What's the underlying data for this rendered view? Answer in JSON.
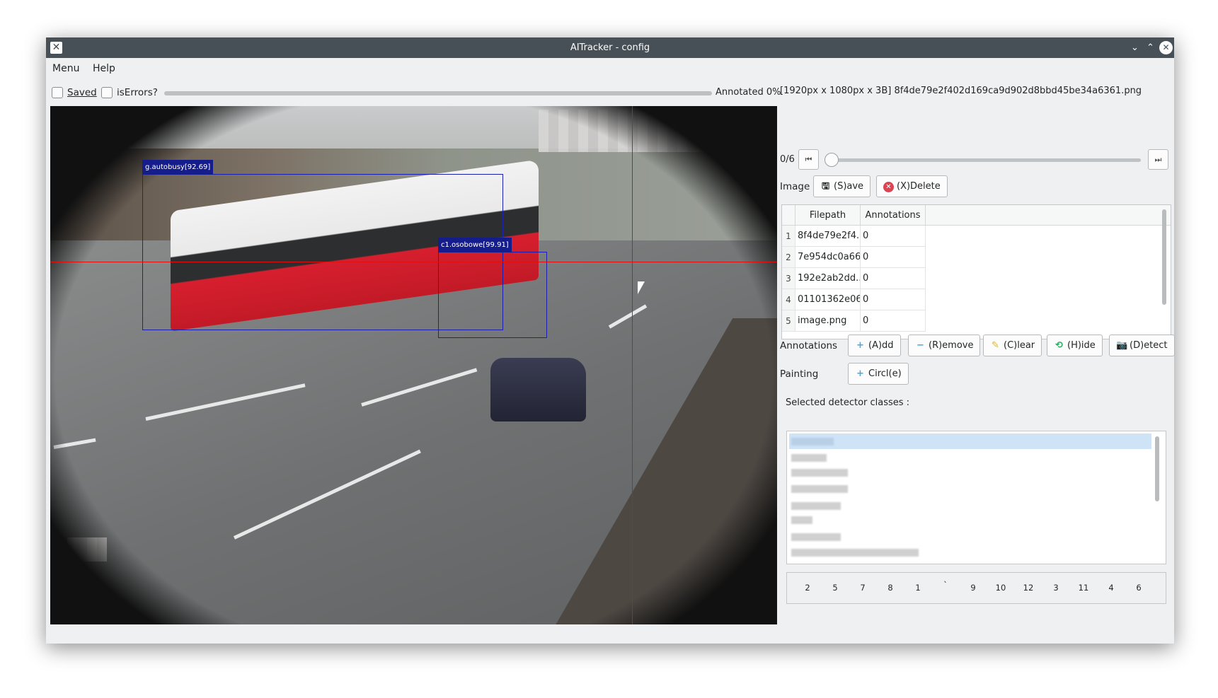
{
  "window": {
    "title": "AITracker - config"
  },
  "menu": {
    "items": [
      "Menu",
      "Help"
    ]
  },
  "toolbar": {
    "saved_label": "Saved",
    "errors_label": "isErrors?",
    "annotated_label": "Annotated 0%"
  },
  "image_info": "[1920px x 1080px x 3B] 8f4de79e2f402d169ca9d902d8bbd45be34a6361.png",
  "navigation": {
    "counter": "0/6",
    "slider_value": 0
  },
  "image_panel": {
    "label": "Image",
    "save": "(S)ave",
    "delete": "(X)Delete"
  },
  "table": {
    "headers": [
      "Filepath",
      "Annotations"
    ],
    "rows": [
      {
        "n": "1",
        "path": "8f4de79e2f4...",
        "ann": "0"
      },
      {
        "n": "2",
        "path": "7e954dc0a66...",
        "ann": "0"
      },
      {
        "n": "3",
        "path": "192e2ab2dd...",
        "ann": "0"
      },
      {
        "n": "4",
        "path": "01101362e06...",
        "ann": "0"
      },
      {
        "n": "5",
        "path": "image.png",
        "ann": "0"
      }
    ]
  },
  "annotations": {
    "label": "Annotations",
    "add": "(A)dd",
    "remove": "(R)emove",
    "clear": "(C)lear",
    "hide": "(H)ide",
    "detect": "(D)etect"
  },
  "painting": {
    "label": "Painting",
    "circle": "Circl(e)"
  },
  "detector": {
    "label": "Selected detector classes :"
  },
  "class_numbers": [
    "2",
    "5",
    "7",
    "8",
    "1",
    "`",
    "9",
    "10",
    "12",
    "3",
    "11",
    "4",
    "6"
  ],
  "detections": [
    {
      "label": "g.autobusy[92.69]"
    },
    {
      "label": "c1.osobowe[99.91]"
    }
  ],
  "colors": {
    "bbox": "#1a1fb0",
    "crosshair": "#e01010",
    "selection": "#cfe3f7"
  }
}
